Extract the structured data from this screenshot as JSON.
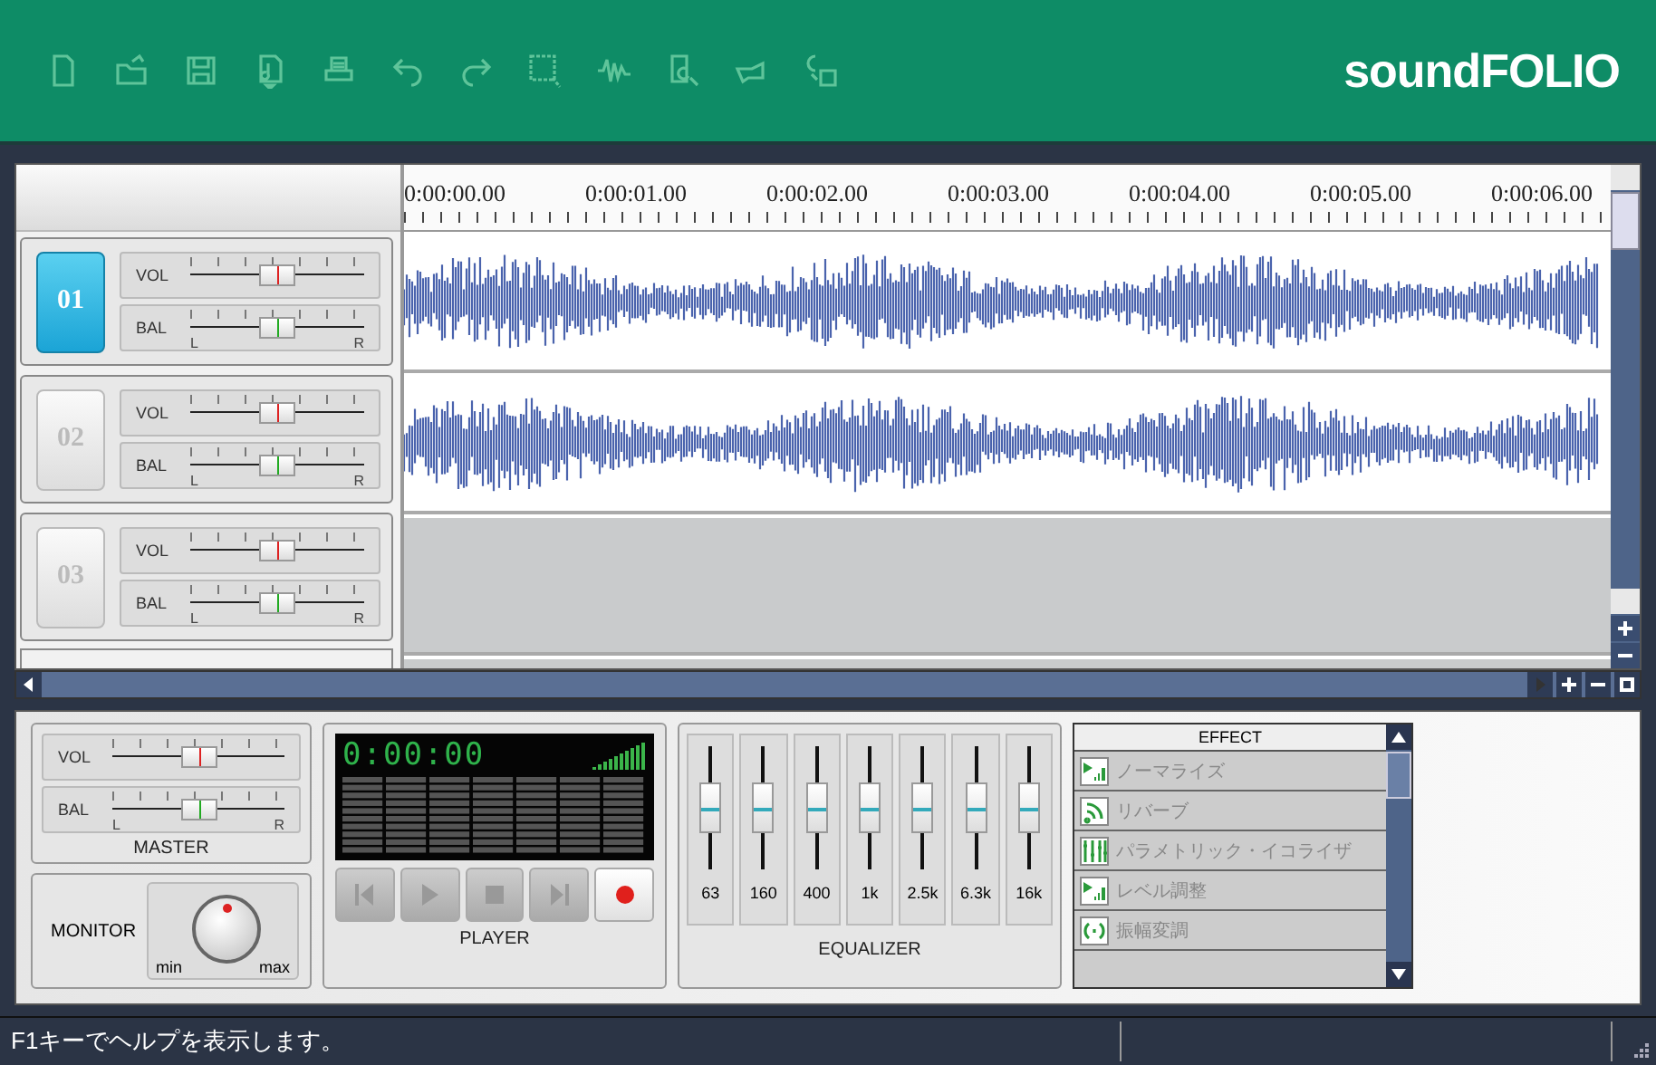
{
  "toolbar": {
    "logo": "soundFOLIO"
  },
  "timeline": {
    "marks": [
      "0:00:00.00",
      "0:00:01.00",
      "0:00:02.00",
      "0:00:03.00",
      "0:00:04.00",
      "0:00:05.00",
      "0:00:06.00"
    ]
  },
  "tracks": [
    {
      "number": "01",
      "selected": true,
      "has_audio": true,
      "vol": {
        "label": "VOL",
        "level": 0.5
      },
      "bal": {
        "label": "BAL",
        "level": 0.5,
        "left": "L",
        "right": "R"
      }
    },
    {
      "number": "02",
      "selected": false,
      "has_audio": true,
      "vol": {
        "label": "VOL",
        "level": 0.5
      },
      "bal": {
        "label": "BAL",
        "level": 0.5,
        "left": "L",
        "right": "R"
      }
    },
    {
      "number": "03",
      "selected": false,
      "has_audio": false,
      "vol": {
        "label": "VOL",
        "level": 0.5
      },
      "bal": {
        "label": "BAL",
        "level": 0.5,
        "left": "L",
        "right": "R"
      }
    }
  ],
  "master": {
    "title": "MASTER",
    "vol": {
      "label": "VOL",
      "level": 0.5
    },
    "bal": {
      "label": "BAL",
      "level": 0.5,
      "left": "L",
      "right": "R"
    }
  },
  "monitor": {
    "label": "MONITOR",
    "min": "min",
    "max": "max"
  },
  "player": {
    "title": "PLAYER",
    "time": "0:00:00",
    "buttons": [
      {
        "kind": "prev",
        "on": false
      },
      {
        "kind": "play",
        "on": false
      },
      {
        "kind": "stop",
        "on": false
      },
      {
        "kind": "next",
        "on": false
      },
      {
        "kind": "record",
        "on": true
      }
    ]
  },
  "equalizer": {
    "title": "EQUALIZER",
    "bands": [
      {
        "label": "63",
        "level": 0.5
      },
      {
        "label": "160",
        "level": 0.5
      },
      {
        "label": "400",
        "level": 0.5
      },
      {
        "label": "1k",
        "level": 0.5
      },
      {
        "label": "2.5k",
        "level": 0.5
      },
      {
        "label": "6.3k",
        "level": 0.5
      },
      {
        "label": "16k",
        "level": 0.5
      }
    ]
  },
  "effects": {
    "title": "EFFECT",
    "items": [
      {
        "label": "ノーマライズ",
        "kind": "level"
      },
      {
        "label": "リバーブ",
        "kind": "reverb"
      },
      {
        "label": "パラメトリック・イコライザ",
        "kind": "eq"
      },
      {
        "label": "レベル調整",
        "kind": "level"
      },
      {
        "label": "振幅変調",
        "kind": "modulation"
      }
    ]
  },
  "status_bar": {
    "text": "F1キーでヘルプを表示します。"
  }
}
